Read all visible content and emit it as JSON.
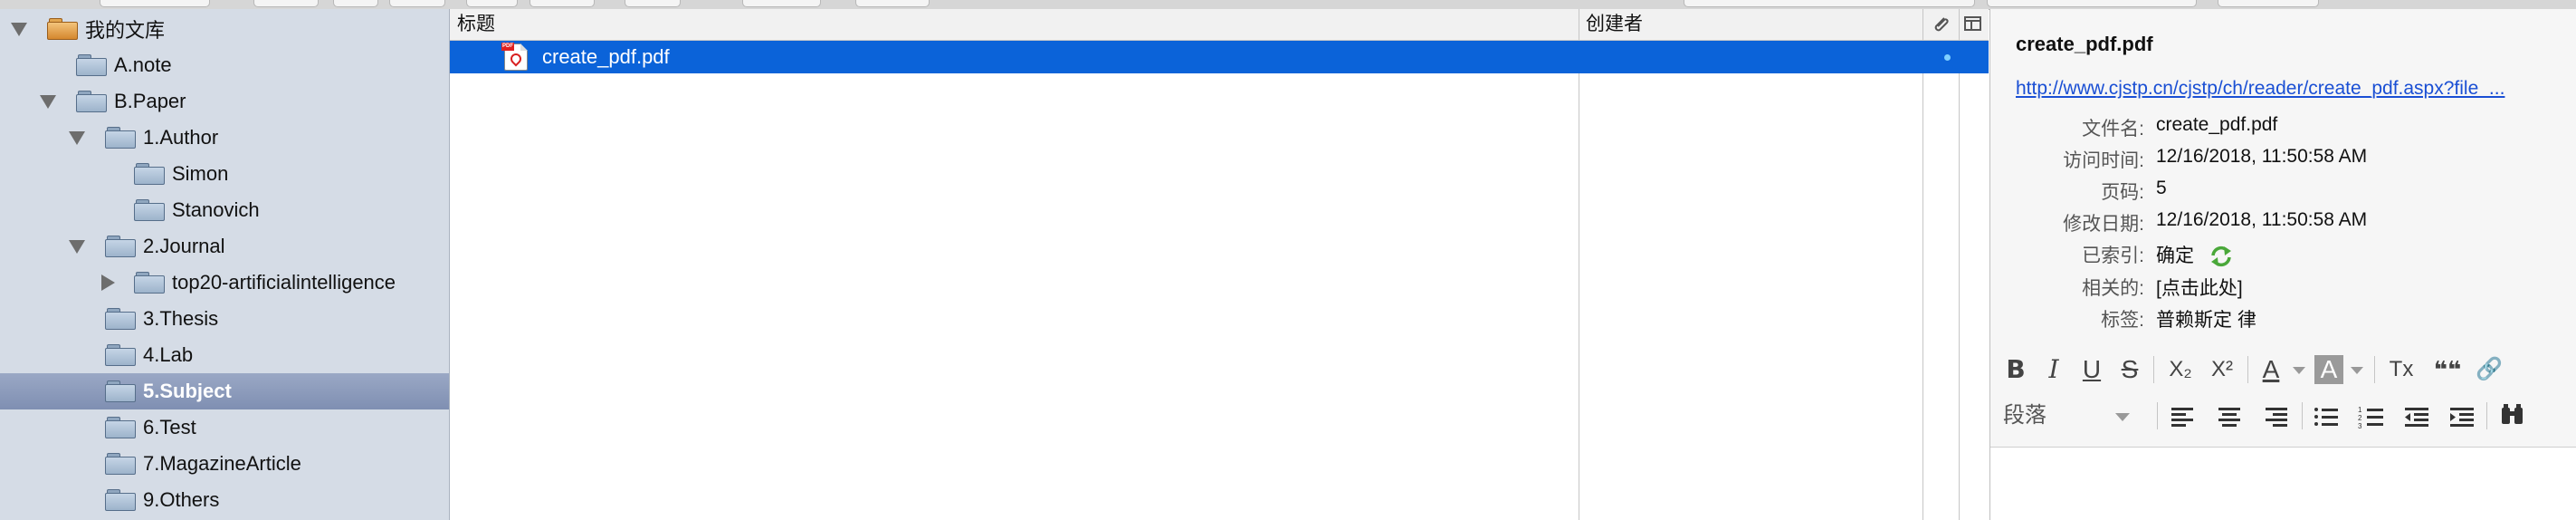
{
  "sidebar": {
    "items": [
      {
        "label": "我的文库",
        "expanded": true
      },
      {
        "label": "A.note"
      },
      {
        "label": "B.Paper",
        "expanded": true
      },
      {
        "label": "1.Author",
        "expanded": true
      },
      {
        "label": "Simon"
      },
      {
        "label": "Stanovich"
      },
      {
        "label": "2.Journal",
        "expanded": true
      },
      {
        "label": "top20-artificialintelligence",
        "expanded": false
      },
      {
        "label": "3.Thesis"
      },
      {
        "label": "4.Lab"
      },
      {
        "label": "5.Subject",
        "selected": true
      },
      {
        "label": "6.Test"
      },
      {
        "label": "7.MagazineArticle"
      },
      {
        "label": "9.Others"
      }
    ]
  },
  "items": {
    "columns": {
      "title": "标题",
      "creator": "创建者"
    },
    "rows": [
      {
        "title": "create_pdf.pdf",
        "creator": "",
        "selected": true
      }
    ]
  },
  "info": {
    "title": "create_pdf.pdf",
    "url": "http://www.cjstp.cn/cjstp/ch/reader/create_pdf.aspx?file_...",
    "fields": [
      {
        "label": "文件名:",
        "value": "create_pdf.pdf"
      },
      {
        "label": "访问时间:",
        "value": "12/16/2018, 11:50:58 AM"
      },
      {
        "label": "页码:",
        "value": "5"
      },
      {
        "label": "修改日期:",
        "value": "12/16/2018, 11:50:58 AM"
      },
      {
        "label": "已索引:",
        "value": "确定"
      },
      {
        "label": "相关的:",
        "value": "[点击此处]"
      },
      {
        "label": "标签:",
        "value": "普赖斯定 律"
      }
    ]
  },
  "editor": {
    "paragraph_format": "段落",
    "buttons_row1": {
      "bold": "B",
      "italic": "I",
      "underline": "U",
      "strike": "S",
      "subscript": "X₂",
      "superscript": "X²",
      "text_color": "A",
      "highlight": "A",
      "clear_format": "Tx",
      "blockquote": "❝❝",
      "link": "🔗"
    }
  },
  "colors": {
    "selection": "#0b63d9",
    "sidebar_bg": "#d5dce6",
    "sidebar_selected": "#8796b8",
    "link": "#1a4fd4"
  }
}
